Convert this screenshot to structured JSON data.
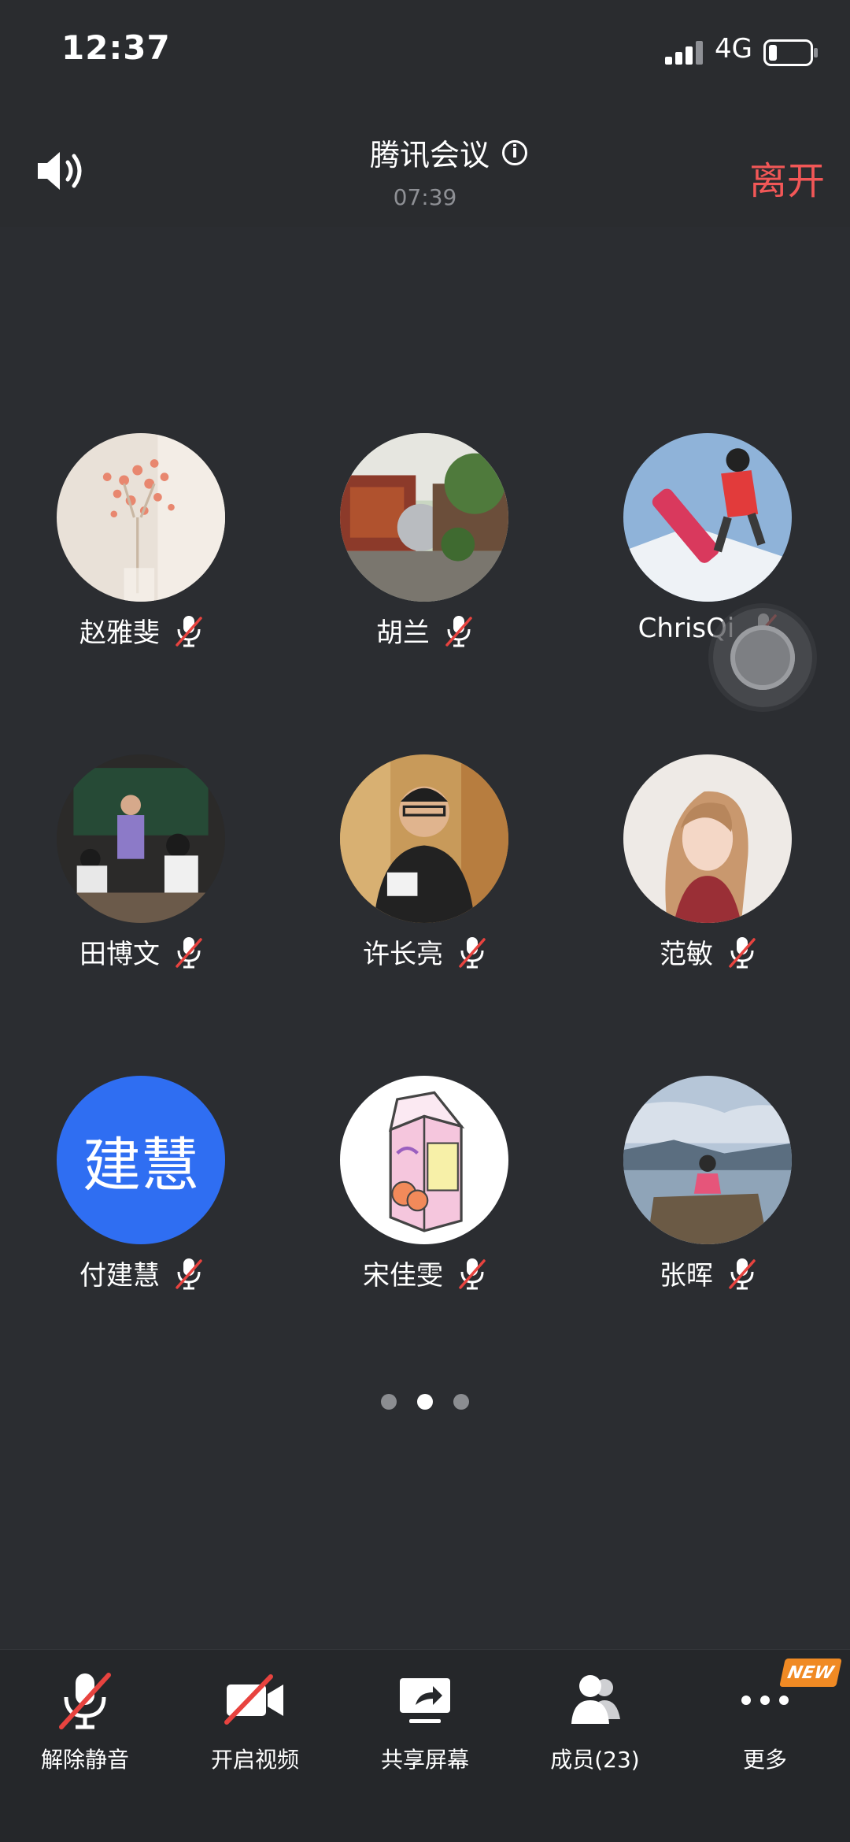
{
  "status_bar": {
    "time": "12:37",
    "network": "4G"
  },
  "header": {
    "title": "腾讯会议",
    "duration": "07:39",
    "leave_label": "离开"
  },
  "participants": [
    {
      "name": "赵雅斐",
      "muted": true
    },
    {
      "name": "胡兰",
      "muted": true
    },
    {
      "name": "ChrisQi",
      "muted": true
    },
    {
      "name": "田博文",
      "muted": true
    },
    {
      "name": "许长亮",
      "muted": true
    },
    {
      "name": "范敏",
      "muted": true
    },
    {
      "name": "付建慧",
      "muted": true,
      "avatar_text": "建慧"
    },
    {
      "name": "宋佳雯",
      "muted": true
    },
    {
      "name": "张晖",
      "muted": true
    }
  ],
  "pager": {
    "total": 3,
    "active": 2
  },
  "toolbar": {
    "unmute_label": "解除静音",
    "video_label": "开启视频",
    "share_label": "共享屏幕",
    "members_label": "成员(23)",
    "more_label": "更多",
    "new_badge": "NEW"
  },
  "colors": {
    "leave": "#f25757",
    "mute_slash": "#e8433f",
    "avatar_blue": "#2f6ef2",
    "badge": "#f08a24"
  }
}
